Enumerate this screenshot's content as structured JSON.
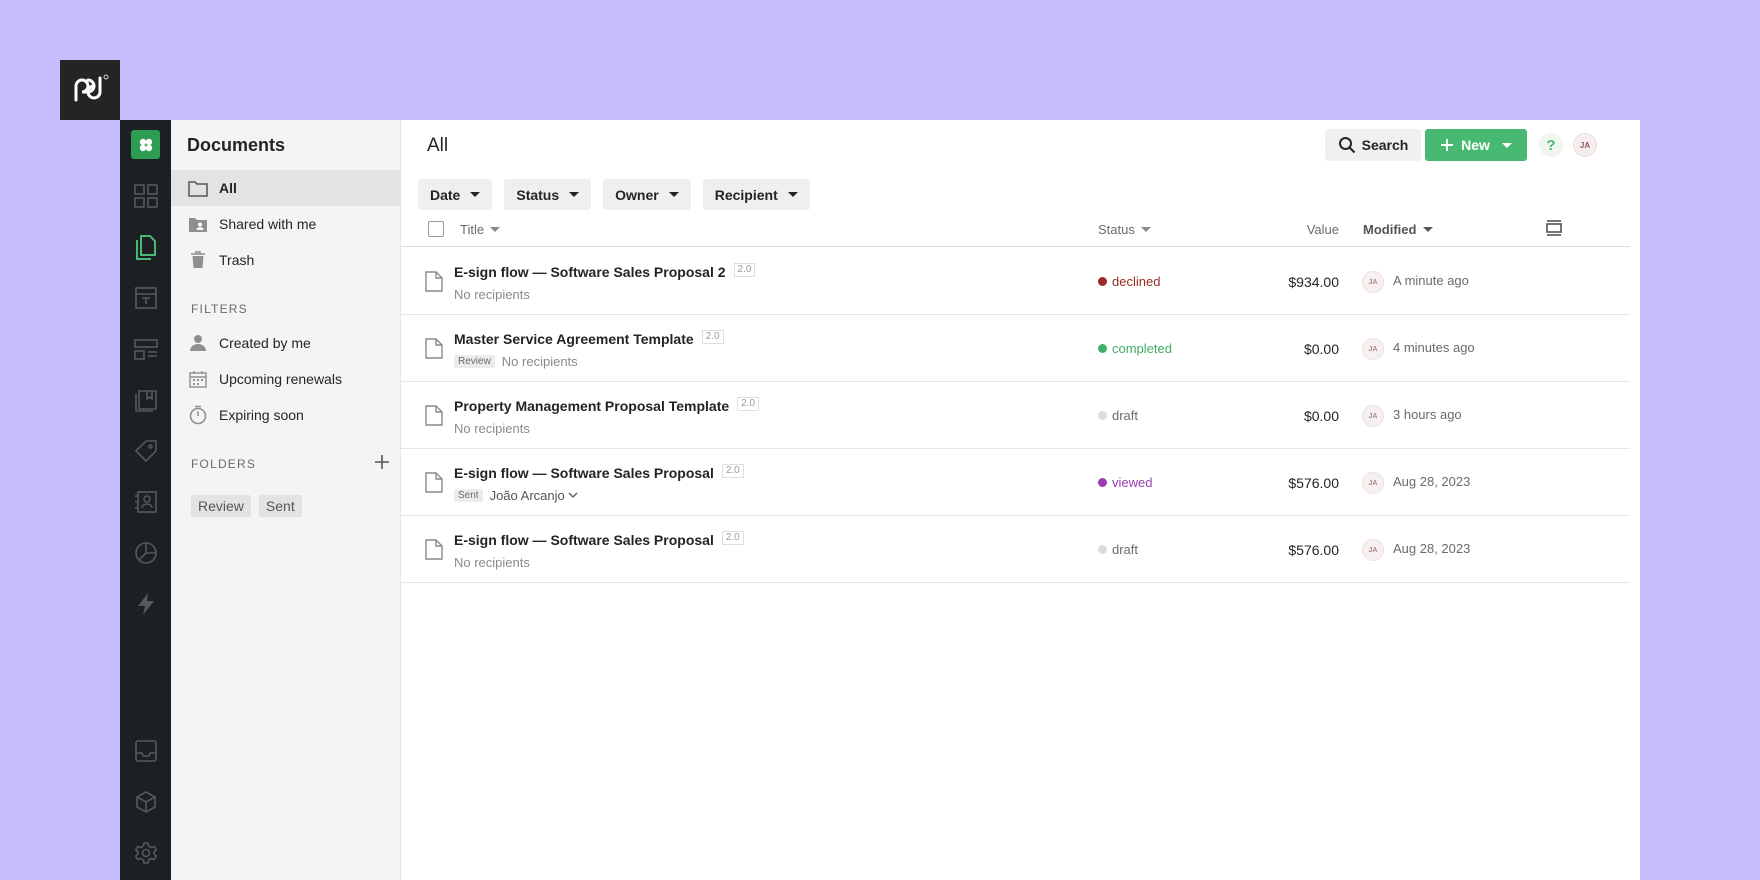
{
  "app": {
    "logo": "pd"
  },
  "rail": {
    "brand_icon": "clover-icon",
    "items": [
      "dashboard-icon",
      "documents-icon",
      "templates-icon",
      "content-library-icon",
      "catalog-icon",
      "tag-icon",
      "contacts-icon",
      "reports-icon",
      "automation-icon",
      "inbox-icon",
      "integrations-icon",
      "settings-icon"
    ]
  },
  "sidebar": {
    "title": "Documents",
    "nav": [
      {
        "label": "All",
        "icon": "folder-icon",
        "active": true
      },
      {
        "label": "Shared with me",
        "icon": "shared-folder-icon"
      },
      {
        "label": "Trash",
        "icon": "trash-icon"
      }
    ],
    "filters_heading": "FILTERS",
    "filters": [
      {
        "label": "Created by me",
        "icon": "user-icon"
      },
      {
        "label": "Upcoming renewals",
        "icon": "calendar-icon"
      },
      {
        "label": "Expiring soon",
        "icon": "timer-icon"
      }
    ],
    "folders_heading": "FOLDERS",
    "folders": [
      "Review",
      "Sent"
    ]
  },
  "main": {
    "title": "All",
    "search_label": "Search",
    "new_label": "New",
    "help_label": "?",
    "user_initials": "JA",
    "filters": [
      "Date",
      "Status",
      "Owner",
      "Recipient"
    ],
    "columns": {
      "title": "Title",
      "status": "Status",
      "value": "Value",
      "modified": "Modified"
    },
    "rows": [
      {
        "title": "E-sign flow — Software Sales Proposal 2",
        "version": "2.0",
        "tag": "",
        "recipients": "No recipients",
        "status": "declined",
        "status_color": "#9a2a22",
        "value": "$934.00",
        "initials": "JA",
        "modified": "A minute ago"
      },
      {
        "title": "Master Service Agreement Template",
        "version": "2.0",
        "tag": "Review",
        "recipients": "No recipients",
        "status": "completed",
        "status_color": "#3fae66",
        "value": "$0.00",
        "initials": "JA",
        "modified": "4 minutes ago"
      },
      {
        "title": "Property Management Proposal Template",
        "version": "2.0",
        "tag": "",
        "recipients": "No recipients",
        "status": "draft",
        "status_color": "#dcdcdc",
        "value": "$0.00",
        "initials": "JA",
        "modified": "3 hours ago"
      },
      {
        "title": "E-sign flow — Software Sales Proposal",
        "version": "2.0",
        "tag": "Sent",
        "recipients": "João Arcanjo",
        "status": "viewed",
        "status_color": "#9a3cb0",
        "value": "$576.00",
        "initials": "JA",
        "modified": "Aug 28, 2023"
      },
      {
        "title": "E-sign flow — Software Sales Proposal",
        "version": "2.0",
        "tag": "",
        "recipients": "No recipients",
        "status": "draft",
        "status_color": "#dcdcdc",
        "value": "$576.00",
        "initials": "JA",
        "modified": "Aug 28, 2023"
      }
    ]
  },
  "colors": {
    "background": "#c5bdfd",
    "rail": "#1c1f23",
    "brand_green": "#47b972"
  }
}
